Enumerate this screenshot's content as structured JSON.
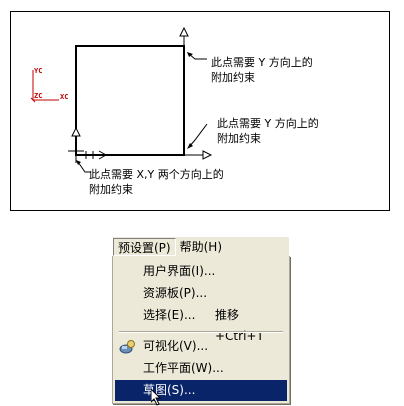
{
  "diagram": {
    "axis_labels": {
      "yc": "YC",
      "zc": "ZC",
      "xc": "XC"
    },
    "notes": {
      "top_right": [
        "此点需要 Y 方向上的",
        "附加约束"
      ],
      "mid_right": [
        "此点需要 Y 方向上的",
        "附加约束"
      ],
      "bottom_left": [
        "此点需要 X,Y 两个方向上的",
        "附加约束"
      ]
    }
  },
  "menu_bar": {
    "items": [
      {
        "label": "预设置(P)"
      },
      {
        "label": "帮助(H)"
      }
    ]
  },
  "dropdown": {
    "items": [
      {
        "label": "用户界面(I)...",
        "shortcut": ""
      },
      {
        "label": "资源板(P)...",
        "shortcut": ""
      },
      {
        "label": "选择(E)...",
        "shortcut": "推移+Ctrl+T"
      },
      {
        "label": "可视化(V)...",
        "shortcut": "",
        "icon": "visualization-icon"
      },
      {
        "label": "工作平面(W)...",
        "shortcut": ""
      },
      {
        "label": "草图(S)...",
        "shortcut": "",
        "highlighted": true
      }
    ]
  },
  "colors": {
    "menu_bg": "#ece9d8",
    "highlight": "#0a246a",
    "axis": "#c00000"
  }
}
